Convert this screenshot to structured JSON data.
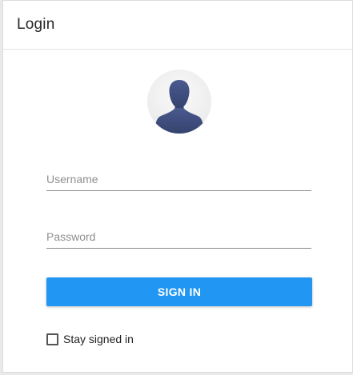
{
  "dialog": {
    "title": "Login"
  },
  "avatar": {
    "icon": "user-silhouette-icon",
    "color": "#3b4a7a"
  },
  "form": {
    "username": {
      "value": "",
      "placeholder": "Username"
    },
    "password": {
      "value": "",
      "placeholder": "Password"
    },
    "signin_label": "SIGN IN",
    "remember": {
      "label": "Stay signed in",
      "checked": false
    }
  },
  "colors": {
    "accent": "#2196f3",
    "background": "#e9e9e9",
    "card": "#ffffff"
  }
}
